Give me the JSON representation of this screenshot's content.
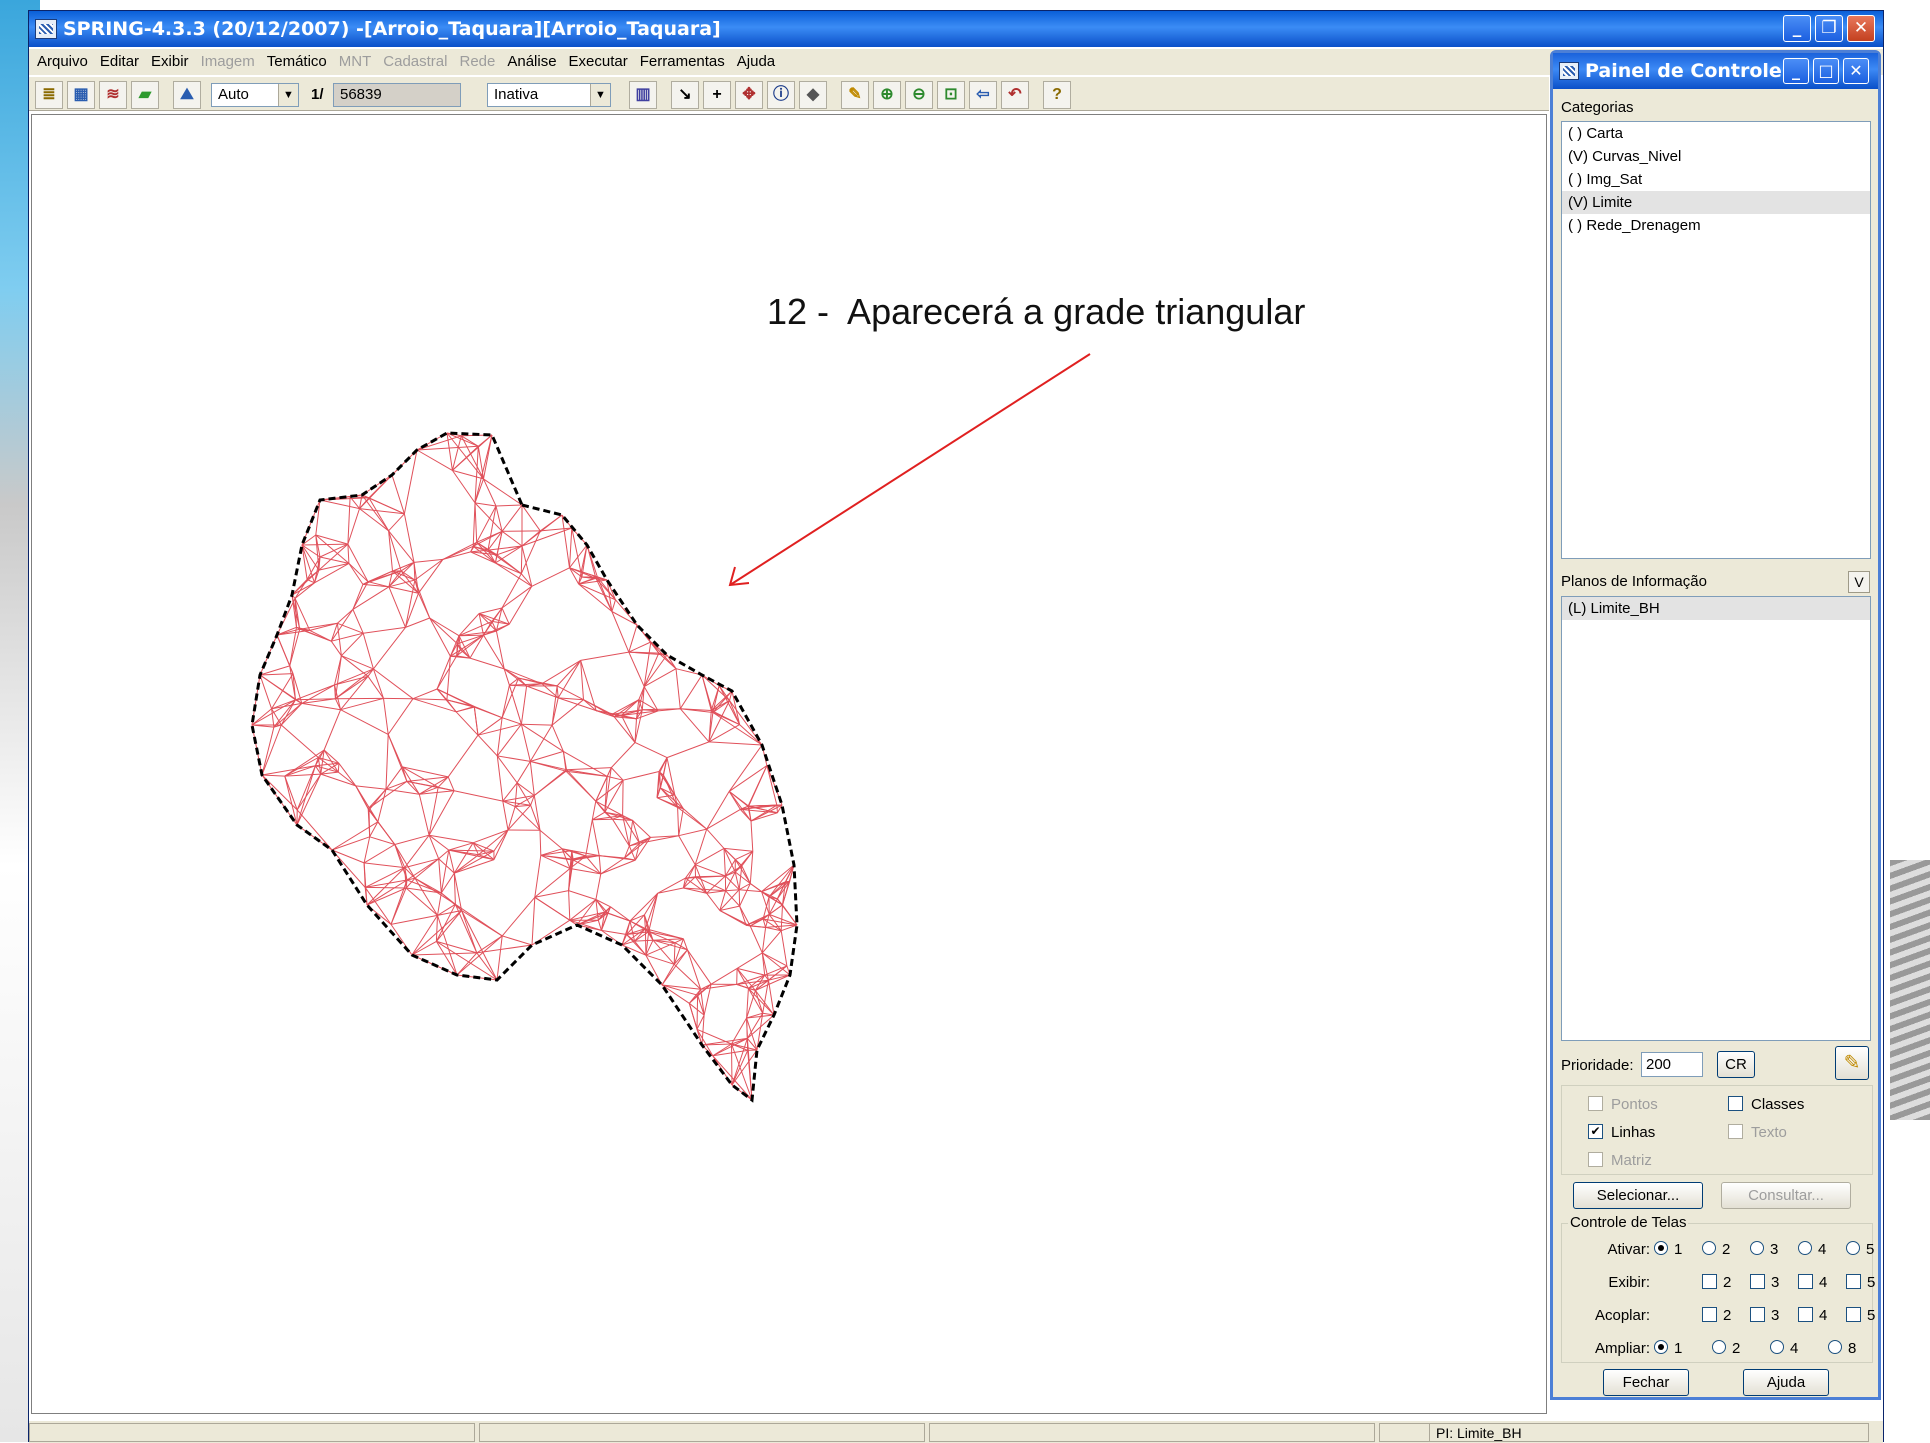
{
  "window": {
    "title": "SPRING-4.3.3 (20/12/2007) -[Arroio_Taquara][Arroio_Taquara]",
    "minimize": "_",
    "restore": "❐",
    "close": "✕"
  },
  "menu": [
    {
      "label": "Arquivo",
      "enabled": true
    },
    {
      "label": "Editar",
      "enabled": true
    },
    {
      "label": "Exibir",
      "enabled": true
    },
    {
      "label": "Imagem",
      "enabled": false
    },
    {
      "label": "Temático",
      "enabled": true
    },
    {
      "label": "MNT",
      "enabled": false
    },
    {
      "label": "Cadastral",
      "enabled": false
    },
    {
      "label": "Rede",
      "enabled": false
    },
    {
      "label": "Análise",
      "enabled": true
    },
    {
      "label": "Executar",
      "enabled": true
    },
    {
      "label": "Ferramentas",
      "enabled": true
    },
    {
      "label": "Ajuda",
      "enabled": true
    }
  ],
  "toolbar": {
    "scale_mode": "Auto",
    "scale_prefix": "1/",
    "scale_value": "56839",
    "mode": "Inativa",
    "icons": [
      "database-icon",
      "project-icon",
      "layers-icon",
      "plane-icon",
      "map-icon",
      "table-icon",
      "cursor-icon",
      "add-icon",
      "pan-icon",
      "info-icon",
      "drop-icon",
      "edit-icon",
      "zoom-in-icon",
      "zoom-out-icon",
      "zoom-area-icon",
      "back-icon",
      "undo-icon",
      "help-icon"
    ]
  },
  "canvas": {
    "annotation": "12 -  Aparecerá a grade triangular",
    "mesh_color": "#e0505a",
    "boundary_color": "#000000",
    "arrow_color": "#e02020"
  },
  "status": {
    "cells": [
      "",
      "",
      "",
      ""
    ],
    "pi": "PI: Limite_BH"
  },
  "panel": {
    "title": "Painel de Controle",
    "categories_label": "Categorias",
    "categories": [
      {
        "label": "( ) Carta",
        "selected": false
      },
      {
        "label": "(V) Curvas_Nivel",
        "selected": false
      },
      {
        "label": "( ) Img_Sat",
        "selected": false
      },
      {
        "label": "(V) Limite",
        "selected": true
      },
      {
        "label": "( ) Rede_Drenagem",
        "selected": false
      }
    ],
    "planos_label": "Planos de Informação",
    "planos_v": "V",
    "planos": [
      {
        "label": "(L) Limite_BH",
        "selected": true
      }
    ],
    "prioridade_label": "Prioridade:",
    "prioridade_value": "200",
    "cr_label": "CR",
    "checks": [
      {
        "label": "Pontos",
        "checked": false,
        "enabled": false
      },
      {
        "label": "Classes",
        "checked": false,
        "enabled": true
      },
      {
        "label": "Linhas",
        "checked": true,
        "enabled": true
      },
      {
        "label": "Texto",
        "checked": false,
        "enabled": false
      },
      {
        "label": "Matriz",
        "checked": false,
        "enabled": false
      }
    ],
    "selecionar": "Selecionar...",
    "consultar": "Consultar...",
    "controle_label": "Controle de Telas",
    "ativar_label": "Ativar:",
    "exibir_label": "Exibir:",
    "acoplar_label": "Acoplar:",
    "ampliar_label": "Ampliar:",
    "screens": [
      "1",
      "2",
      "3",
      "4",
      "5"
    ],
    "ampliar_values": [
      "1",
      "2",
      "4",
      "8"
    ],
    "fechar": "Fechar",
    "ajuda": "Ajuda"
  }
}
